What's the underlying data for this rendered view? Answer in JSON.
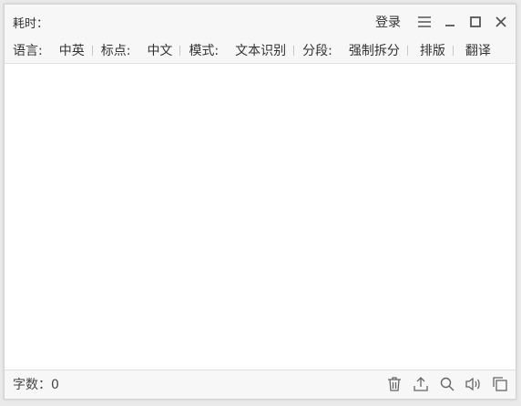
{
  "titlebar": {
    "time_label": "耗时：",
    "login_label": "登录"
  },
  "options": {
    "language_label": "语言:",
    "language_value": "中英",
    "punct_label": "标点:",
    "punct_value": "中文",
    "mode_label": "模式:",
    "mode_value": "文本识别",
    "segment_label": "分段:",
    "segment_value": "强制拆分",
    "layout_label": "排版",
    "translate_label": "翻译"
  },
  "editor": {
    "content": ""
  },
  "status": {
    "count_label": "字数：0"
  },
  "icons": {
    "menu": "menu-icon",
    "minimize": "minimize-icon",
    "maximize": "maximize-icon",
    "close": "close-icon",
    "delete": "trash-icon",
    "export": "upload-icon",
    "search": "search-icon",
    "speak": "speaker-icon",
    "copy": "copy-icon"
  },
  "colors": {
    "icon": "#555555",
    "background": "#f7f7f7",
    "editor": "#ffffff"
  }
}
